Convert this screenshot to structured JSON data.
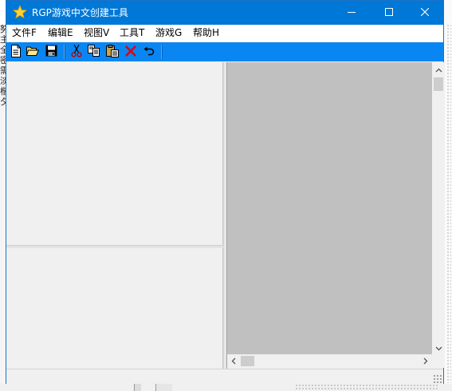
{
  "window": {
    "title": "RGP游戏中文创建工具",
    "icon": "star-icon",
    "accent_color": "#0078d7",
    "controls": {
      "minimize": "minimize-icon",
      "maximize": "maximize-icon",
      "close": "close-icon"
    }
  },
  "menu": {
    "items": [
      {
        "label": "文件F"
      },
      {
        "label": "编辑E"
      },
      {
        "label": "视图V"
      },
      {
        "label": "工具T"
      },
      {
        "label": "游戏G"
      },
      {
        "label": "帮助H"
      }
    ]
  },
  "toolbar": {
    "buttons": [
      {
        "icon": "new-file-icon"
      },
      {
        "icon": "open-folder-icon"
      },
      {
        "icon": "save-icon"
      },
      {
        "icon": "cut-icon"
      },
      {
        "icon": "copy-icon"
      },
      {
        "icon": "paste-icon"
      },
      {
        "icon": "delete-icon"
      },
      {
        "icon": "undo-icon"
      }
    ],
    "background_color": "#0a86f2"
  },
  "canvas": {
    "background_color": "#c0c0c0"
  },
  "background_window": {
    "left_edge_chars": [
      "努",
      "主",
      "全",
      "密",
      "需",
      "淡",
      "楷",
      "夕"
    ]
  }
}
